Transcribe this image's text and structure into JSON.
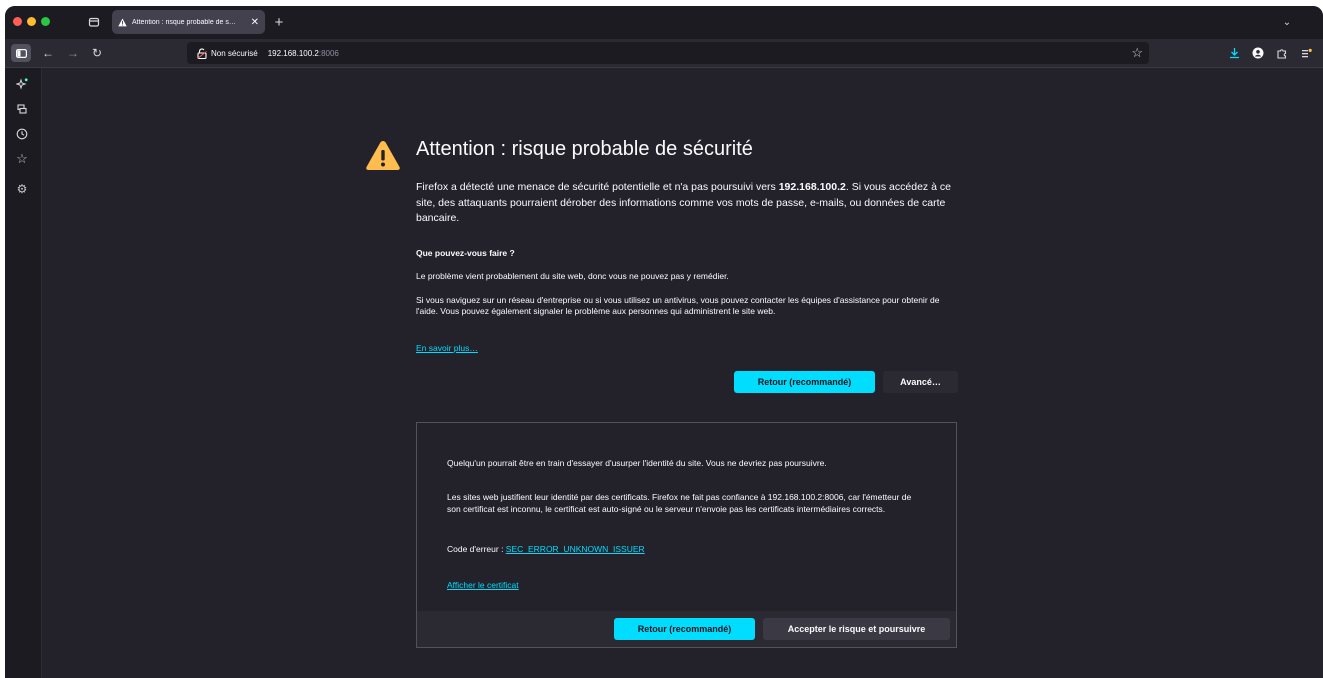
{
  "browser": {
    "tab_title": "Attention : risque probable de s…",
    "url": {
      "security_label": "Non sécurisé",
      "host": "192.168.100.2",
      "port": ":8006"
    }
  },
  "error_page": {
    "title": "Attention : risque probable de sécurité",
    "intro_before": "Firefox a détecté une menace de sécurité potentielle et n'a pas poursuivi vers ",
    "intro_host": "192.168.100.2",
    "intro_after": ". Si vous accédez à ce site, des attaquants pourraient dérober des informations comme vos mots de passe, e-mails, ou données de carte bancaire.",
    "what_heading": "Que pouvez-vous faire ?",
    "paragraph_1": "Le problème vient probablement du site web, donc vous ne pouvez pas y remédier.",
    "paragraph_2": "Si vous naviguez sur un réseau d'entreprise ou si vous utilisez un antivirus, vous pouvez contacter les équipes d'assistance pour obtenir de l'aide. Vous pouvez également signaler le problème aux personnes qui administrent le site web.",
    "learn_more": "En savoir plus…",
    "go_back_label": "Retour (recommandé)",
    "advanced_label": "Avancé…"
  },
  "advanced_panel": {
    "paragraph_1": "Quelqu'un pourrait être en train d'essayer d'usurper l'identité du site. Vous ne devriez pas poursuivre.",
    "paragraph_2": "Les sites web justifient leur identité par des certificats. Firefox ne fait pas confiance à 192.168.100.2:8006, car l'émetteur de son certificat est inconnu, le certificat est auto-signé ou le serveur n'envoie pas les certificats intermédiaires corrects.",
    "error_code_label": "Code d'erreur : ",
    "error_code": "SEC_ERROR_UNKNOWN_ISSUER",
    "show_certificate": "Afficher le certificat",
    "go_back_label": "Retour (recommandé)",
    "accept_label": "Accepter le risque et poursuivre"
  },
  "icons": {
    "warning": "warning-triangle-icon",
    "tabs": "tab-overview-icon",
    "new_tab": "plus-icon",
    "back": "arrow-left-icon",
    "forward": "arrow-right-icon",
    "reload": "reload-icon",
    "not_secure": "broken-lock-icon",
    "bookmark": "star-icon",
    "downloads": "download-icon",
    "account": "account-icon",
    "extensions": "puzzle-icon",
    "menu": "menu-icon"
  },
  "colors": {
    "accent": "#00ddff",
    "warning": "#ffbd4f",
    "page_bg": "#23222b"
  }
}
